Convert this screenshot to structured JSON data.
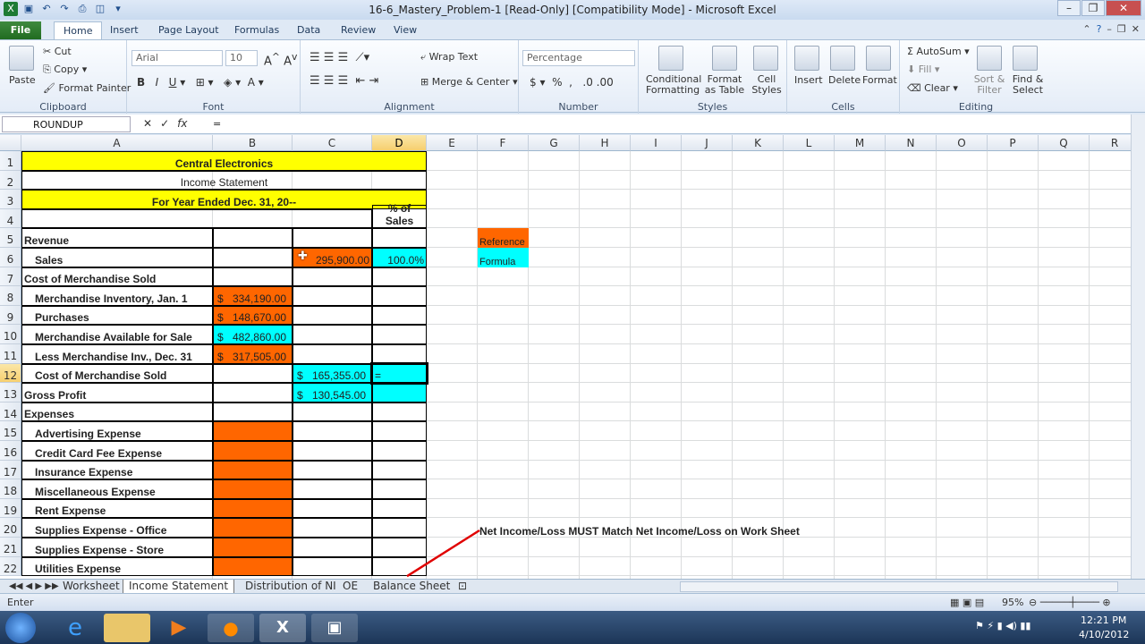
{
  "window": {
    "title": "16-6_Mastery_Problem-1  [Read-Only]  [Compatibility Mode]  -  Microsoft Excel"
  },
  "tabs": [
    "File",
    "Home",
    "Insert",
    "Page Layout",
    "Formulas",
    "Data",
    "Review",
    "View"
  ],
  "ribbon": {
    "clipboard": {
      "label": "Clipboard",
      "paste": "Paste",
      "cut": "Cut",
      "copy": "Copy",
      "format_painter": "Format Painter"
    },
    "font": {
      "label": "Font",
      "name": "Arial",
      "size": "10"
    },
    "alignment": {
      "label": "Alignment",
      "wrap": "Wrap Text",
      "merge": "Merge & Center"
    },
    "number": {
      "label": "Number",
      "format": "Percentage"
    },
    "styles": {
      "label": "Styles",
      "conditional": "Conditional Formatting",
      "format_table": "Format as Table",
      "cell_styles": "Cell Styles"
    },
    "cells": {
      "label": "Cells",
      "insert": "Insert",
      "delete": "Delete",
      "format": "Format"
    },
    "editing": {
      "label": "Editing",
      "autosum": "AutoSum",
      "fill": "Fill",
      "clear": "Clear",
      "sort": "Sort & Filter",
      "find": "Find & Select"
    }
  },
  "formula_bar": {
    "name_box": "ROUNDUP",
    "content": "="
  },
  "columns": [
    "A",
    "B",
    "C",
    "D",
    "E",
    "F",
    "G",
    "H",
    "I",
    "J",
    "K",
    "L",
    "M",
    "N",
    "O",
    "P",
    "Q",
    "R"
  ],
  "rows": [
    "1",
    "2",
    "3",
    "4",
    "5",
    "6",
    "7",
    "8",
    "9",
    "10",
    "11",
    "12",
    "13",
    "14",
    "15",
    "16",
    "17",
    "18",
    "19",
    "20",
    "21",
    "22"
  ],
  "cells": {
    "A1": "Central Electronics",
    "A2": "Income Statement",
    "A3": "For Year Ended Dec. 31, 20--",
    "D4": "% of Sales",
    "A5": "Revenue",
    "A6": "Sales",
    "C6": "295,900.00",
    "D6": "100.0%",
    "A7": "Cost of Merchandise Sold",
    "A8": "Merchandise Inventory, Jan. 1",
    "B8": "334,190.00",
    "A9": "Purchases",
    "B9": "148,670.00",
    "A10": "Merchandise Available for Sale",
    "B10": "482,860.00",
    "A11": "Less Merchandise Inv., Dec. 31",
    "B11": "317,505.00",
    "A12": "Cost of Merchandise Sold",
    "C12": "165,355.00",
    "D12": "=",
    "A13": "Gross Profit",
    "C13": "130,545.00",
    "A14": "Expenses",
    "A15": "Advertising Expense",
    "A16": "Credit Card Fee Expense",
    "A17": "Insurance Expense",
    "A18": "Miscellaneous Expense",
    "A19": "Rent Expense",
    "A20": "Supplies Expense - Office",
    "A21": "Supplies Expense - Store",
    "A22": "Utilities Expense",
    "F5": "Reference",
    "F6": "Formula",
    "F20": "Net Income/Loss MUST Match Net Income/Loss on Work Sheet",
    "currency": "$"
  },
  "sheet_tabs": [
    "Worksheet",
    "Income Statement",
    "Distribution of NI",
    "OE",
    "Balance Sheet"
  ],
  "status": {
    "mode": "Enter",
    "zoom": "95%"
  },
  "taskbar": {
    "time": "12:21 PM",
    "date": "4/10/2012"
  },
  "colors": {
    "yellow": "#ffff00",
    "orange": "#ff6600",
    "cyan": "#00ffff"
  }
}
